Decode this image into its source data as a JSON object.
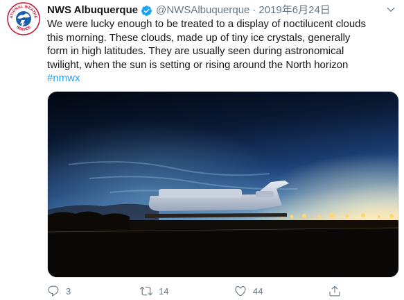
{
  "tweet": {
    "display_name": "NWS Albuquerque",
    "handle": "@NWSAlbuquerque",
    "separator": "·",
    "date": "2019年6月24日",
    "text": "We were lucky enough to be treated to a display of noctilucent clouds\nthis morning. These clouds, made up of tiny ice crystals, generally\nform in high latitudes. They are usually seen during astronomical\ntwilight, when the sun is setting or rising around the North horizon\n",
    "hashtag": "#nmwx",
    "avatar_text_top": "NATIONAL WEATHER",
    "avatar_text_bottom": "SERVICE"
  },
  "actions": {
    "reply_count": "3",
    "retweet_count": "14",
    "like_count": "44"
  },
  "colors": {
    "link": "#1da1f2",
    "muted": "#657786",
    "verified": "#1da1f2"
  },
  "icons": [
    "chevron-down-icon",
    "verified-badge-icon",
    "reply-icon",
    "retweet-icon",
    "like-icon",
    "share-icon"
  ]
}
